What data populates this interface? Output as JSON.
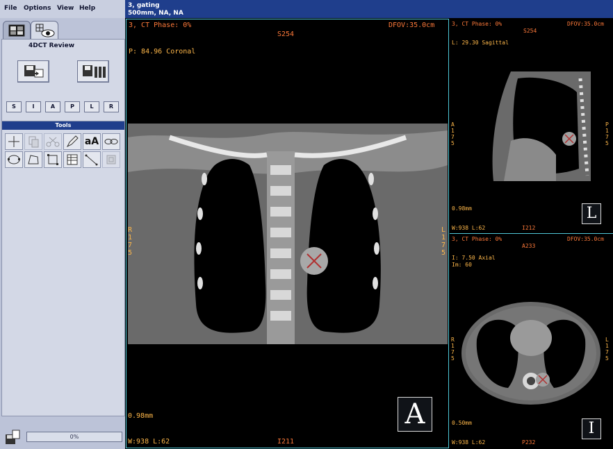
{
  "menu": [
    "File",
    "Options",
    "View",
    "Help"
  ],
  "header": {
    "line1": "3, gating",
    "line2": "500mm, NA, NA"
  },
  "left_panel": {
    "tab_icons": [
      "monitor-grid-icon",
      "eye-grid-icon"
    ],
    "review_title": "4DCT Review",
    "save_buttons": [
      "save-image-icon",
      "save-series-icon"
    ],
    "orientation_buttons": [
      "S",
      "I",
      "A",
      "P",
      "L",
      "R"
    ],
    "tools_title": "Tools",
    "tool_text_icon": "aA",
    "progress": "0%"
  },
  "main_view": {
    "top_left": "3, CT Phase: 0%",
    "top_center": "S254",
    "top_right": "DFOV:35.0cm",
    "position": "P: 84.96 Coronal",
    "left_orient": [
      "R",
      "1",
      "7",
      "5"
    ],
    "right_orient": [
      "L",
      "1",
      "7",
      "5"
    ],
    "scale": "0.98mm",
    "window": "W:938 L:62",
    "bottom_center": "I211",
    "letter": "A"
  },
  "sagittal_view": {
    "top_left": "3, CT Phase: 0%",
    "top_center": "S254",
    "top_right": "DFOV:35.0cm",
    "position": "L: 29.30 Sagittal",
    "left_orient": [
      "A",
      "1",
      "7",
      "5"
    ],
    "right_orient": [
      "P",
      "1",
      "7",
      "5"
    ],
    "scale": "0.98mm",
    "window": "W:938 L:62",
    "bottom_center": "I212",
    "letter": "L"
  },
  "axial_view": {
    "top_left": "3, CT Phase: 0%",
    "top_center": "A233",
    "top_right": "DFOV:35.0cm",
    "position": "I: 7.50 Axial",
    "position2": "Im: 60",
    "left_orient": [
      "R",
      "1",
      "7",
      "5"
    ],
    "right_orient": [
      "L",
      "1",
      "7",
      "5"
    ],
    "scale": "0.50mm",
    "window": "W:938 L:62",
    "bottom_center": "P232",
    "letter": "I"
  },
  "colors": {
    "overlay": "#ff7a3a",
    "overlay_secondary": "#ffb84a",
    "header_bg": "#1f3e8c",
    "panel_bg": "#bcc3d8",
    "viewport_border": "#4fc8d8"
  }
}
